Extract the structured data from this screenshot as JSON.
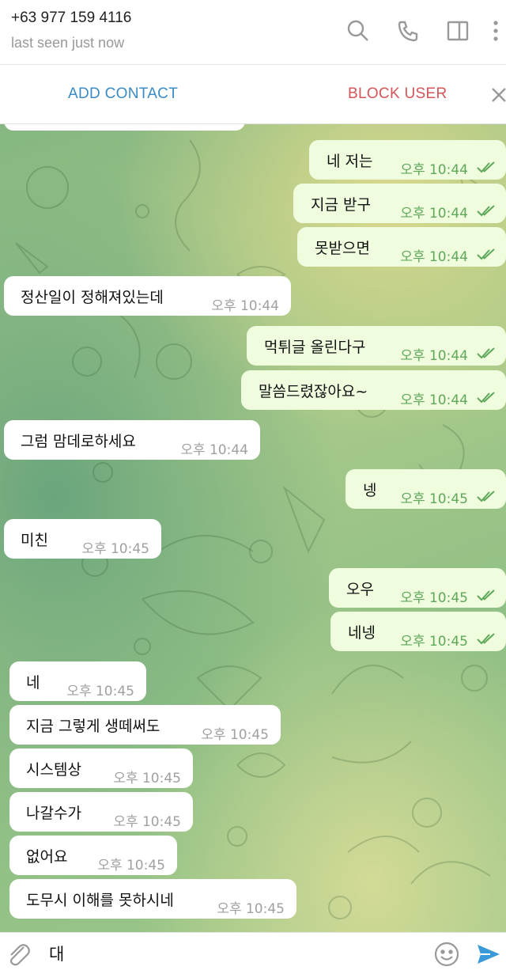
{
  "header": {
    "peer_name": "+63 977 159 4116",
    "peer_status": "last seen just now",
    "icons": [
      "search-icon",
      "phone-icon",
      "sidebar-icon",
      "more-icon"
    ]
  },
  "actionbar": {
    "add_contact": "ADD CONTACT",
    "block_user": "BLOCK USER",
    "close_icon": "close-icon"
  },
  "messages": [
    {
      "dir": "out",
      "text": "네 저는",
      "time": "오후 10:44",
      "read": true
    },
    {
      "dir": "out",
      "text": "지금 받구",
      "time": "오후 10:44",
      "read": true
    },
    {
      "dir": "out",
      "text": "못받으면",
      "time": "오후 10:44",
      "read": true
    },
    {
      "dir": "in",
      "text": "정산일이 정해져있는데",
      "time": "오후 10:44"
    },
    {
      "dir": "out",
      "text": "먹튀글 올린다구",
      "time": "오후 10:44",
      "read": true
    },
    {
      "dir": "out",
      "text": "말씀드렸잖아요~",
      "time": "오후 10:44",
      "read": true
    },
    {
      "dir": "in",
      "text": "그럼 맘데로하세요",
      "time": "오후 10:44"
    },
    {
      "dir": "out",
      "text": "넹",
      "time": "오후 10:45",
      "read": true
    },
    {
      "dir": "in",
      "text": "미친",
      "time": "오후 10:45"
    },
    {
      "dir": "out",
      "text": "오우",
      "time": "오후 10:45",
      "read": true
    },
    {
      "dir": "out",
      "text": "네넹",
      "time": "오후 10:45",
      "read": true
    },
    {
      "dir": "in",
      "text": "네",
      "time": "오후 10:45"
    },
    {
      "dir": "in",
      "text": "지금 그렇게 생떼써도",
      "time": "오후 10:45"
    },
    {
      "dir": "in",
      "text": "시스템상",
      "time": "오후 10:45"
    },
    {
      "dir": "in",
      "text": "나갈수가",
      "time": "오후 10:45"
    },
    {
      "dir": "in",
      "text": "없어요",
      "time": "오후 10:45"
    },
    {
      "dir": "in",
      "text": "도무시 이해를 못하시네",
      "time": "오후 10:45"
    }
  ],
  "composer": {
    "value": "대",
    "icons": [
      "attach-icon",
      "emoji-icon",
      "send-icon"
    ]
  },
  "colors": {
    "accent": "#3a8bc4",
    "danger": "#d2555a",
    "bubble_out": "#effdde",
    "bubble_in": "#ffffff",
    "read_check": "#5fa75a"
  }
}
